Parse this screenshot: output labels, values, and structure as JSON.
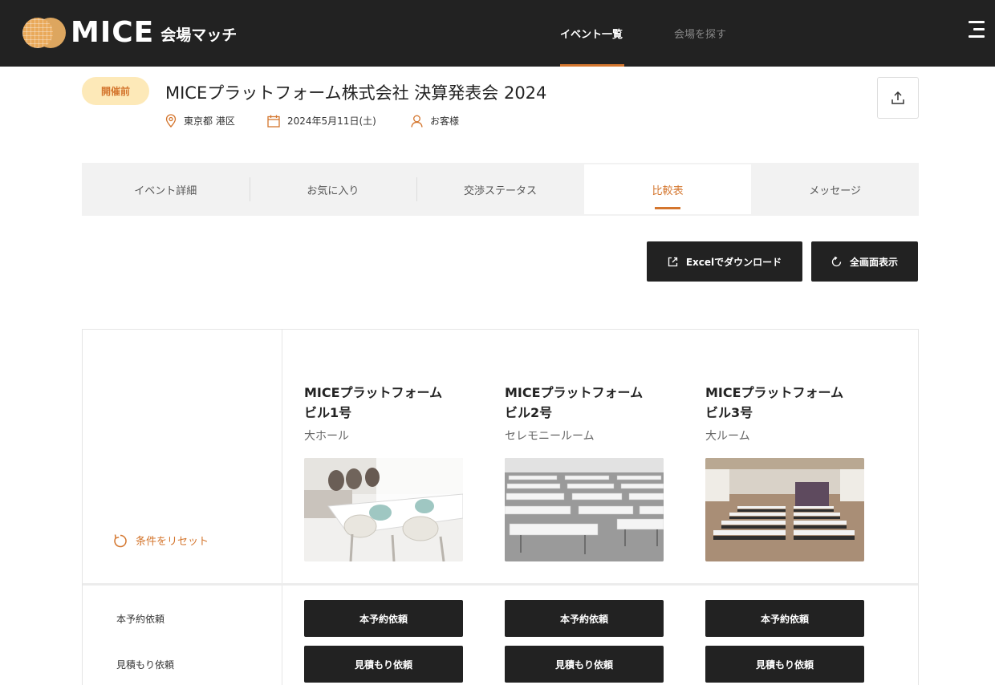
{
  "header": {
    "logo_text": "MICE",
    "logo_sub": "会場マッチ",
    "nav": [
      {
        "label": "イベント一覧",
        "active": true
      },
      {
        "label": "会場を探す",
        "active": false
      }
    ],
    "accent": "#d4762e",
    "bg": "#222222"
  },
  "event": {
    "status": "開催前",
    "title": "MICEプラットフォーム株式会社 決算発表会 2024",
    "location": "東京都 港区",
    "date": "2024年5月11日(土)",
    "customer": "お客様"
  },
  "tabs": [
    {
      "label": "イベント詳細",
      "active": false
    },
    {
      "label": "お気に入り",
      "active": false
    },
    {
      "label": "交渉ステータス",
      "active": false
    },
    {
      "label": "比較表",
      "active": true
    },
    {
      "label": "メッセージ",
      "active": false
    }
  ],
  "actions": {
    "excel": "Excelでダウンロード",
    "fullscreen": "全画面表示"
  },
  "compare": {
    "reset": "条件をリセット",
    "venues": [
      {
        "name_line1": "MICEプラットフォーム",
        "name_line2": "ビル1号",
        "room": "大ホール",
        "image": "meeting-room-photo"
      },
      {
        "name_line1": "MICEプラットフォーム",
        "name_line2": "ビル2号",
        "room": "セレモニールーム",
        "image": "seminar-hall-photo"
      },
      {
        "name_line1": "MICEプラットフォーム",
        "name_line2": "ビル3号",
        "room": "大ルーム",
        "image": "large-room-photo"
      }
    ],
    "rows": [
      {
        "label": "本予約依頼",
        "button": "本予約依頼"
      },
      {
        "label": "見積もり依頼",
        "button": "見積もり依頼"
      }
    ]
  }
}
